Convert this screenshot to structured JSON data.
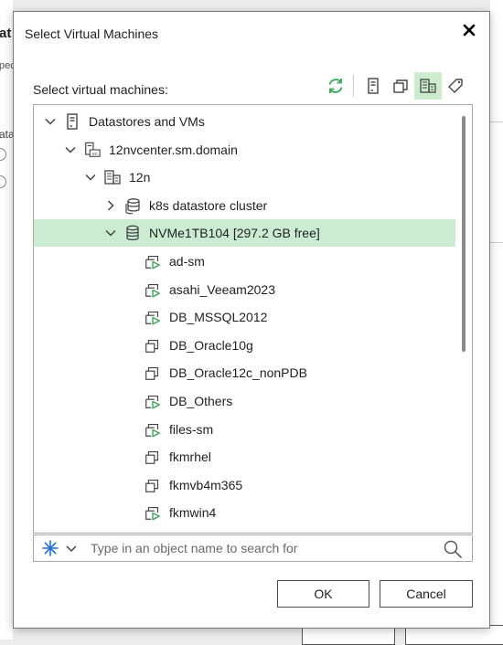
{
  "background": {
    "left_fragments": [
      "at",
      "pec",
      "ata"
    ]
  },
  "dialog": {
    "title": "Select Virtual Machines",
    "select_label": "Select virtual machines:",
    "toolbar": {
      "refresh_icon": "refresh-icon",
      "host_view_icon": "host-icon",
      "vm_folder_view_icon": "vm-folder-icon",
      "datastore_view_icon": "datastore-view-icon",
      "tag_view_icon": "tag-icon",
      "active_view": "datastores"
    },
    "tree": [
      {
        "label": "Datastores and VMs",
        "level": 0,
        "chevron": "down",
        "icon": "server"
      },
      {
        "label": "12nvcenter.sm.domain",
        "level": 1,
        "chevron": "down",
        "icon": "vcenter"
      },
      {
        "label": "12n",
        "level": 2,
        "chevron": "down",
        "icon": "datacenter"
      },
      {
        "label": "k8s datastore cluster",
        "level": 3,
        "chevron": "right",
        "icon": "datastore-cluster"
      },
      {
        "label": "NVMe1TB104 [297.2 GB free]",
        "level": 3,
        "chevron": "down",
        "icon": "datastore",
        "selected": true
      },
      {
        "label": "ad-sm",
        "level": 4,
        "icon": "vm-on"
      },
      {
        "label": "asahi_Veeam2023",
        "level": 4,
        "icon": "vm-on"
      },
      {
        "label": "DB_MSSQL2012",
        "level": 4,
        "icon": "vm-on"
      },
      {
        "label": "DB_Oracle10g",
        "level": 4,
        "icon": "vm-off"
      },
      {
        "label": "DB_Oracle12c_nonPDB",
        "level": 4,
        "icon": "vm-off"
      },
      {
        "label": "DB_Others",
        "level": 4,
        "icon": "vm-on"
      },
      {
        "label": "files-sm",
        "level": 4,
        "icon": "vm-on"
      },
      {
        "label": "fkmrhel",
        "level": 4,
        "icon": "vm-off"
      },
      {
        "label": "fkmvb4m365",
        "level": 4,
        "icon": "vm-off"
      },
      {
        "label": "fkmwin4",
        "level": 4,
        "icon": "vm-on"
      }
    ],
    "search": {
      "placeholder": "Type in an object name to search for",
      "value": ""
    },
    "ok_label": "OK",
    "cancel_label": "Cancel"
  },
  "colors": {
    "accent_green": "#3aa655",
    "selection_bg": "#ccecd2",
    "filter_blue": "#1e6fd9"
  }
}
